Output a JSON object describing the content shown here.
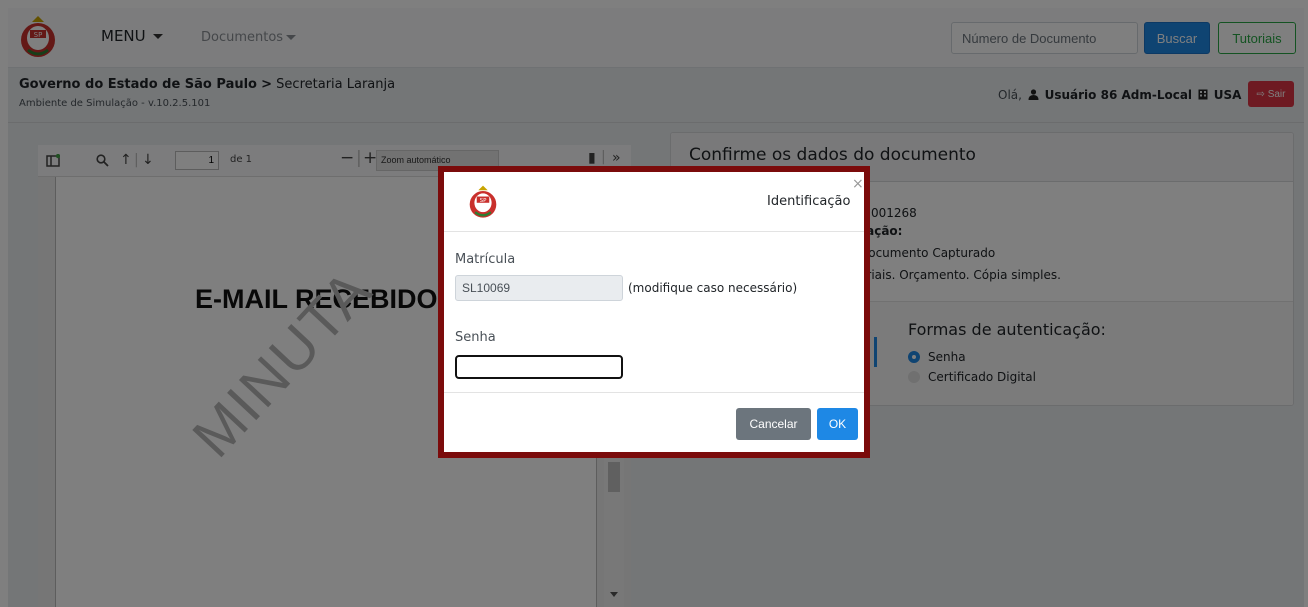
{
  "navbar": {
    "menu_label": "MENU",
    "documents_label": "Documentos",
    "search_placeholder": "Número de Documento",
    "search_button": "Buscar",
    "tutorials_button": "Tutoriais"
  },
  "subheader": {
    "breadcrumb_root": "Governo do Estado de São Paulo",
    "breadcrumb_separator": ">",
    "breadcrumb_current": "Secretaria Laranja",
    "environment": "Ambiente de Simulação - v.10.2.5.101",
    "greeting": "Olá,",
    "user_name": "Usuário 86 Adm-Local",
    "unit": "USA",
    "logout_button": "Sair"
  },
  "viewer": {
    "page_number": "1",
    "page_total": "de 1",
    "zoom": "Zoom automático",
    "document_title": "E-MAIL RECEBIDO",
    "watermark": "MINUTA"
  },
  "card": {
    "title": "Confirme os dados do documento",
    "doc_number_fragment": "-1001268",
    "classification_fragment": "cação:",
    "type_fragment": "Documento Capturado",
    "description_fragment": "eriais. Orçamento. Cópia simples.",
    "auth_title": "Formas de autenticação:",
    "auth_options": [
      {
        "label": "Senha",
        "selected": true
      },
      {
        "label": "Certificado Digital",
        "selected": false
      }
    ]
  },
  "modal": {
    "title": "Identificação",
    "close": "×",
    "matricula_label": "Matrícula",
    "matricula_value": "SL10069",
    "matricula_hint": "(modifique caso necessário)",
    "senha_label": "Senha",
    "cancel_button": "Cancelar",
    "ok_button": "OK"
  },
  "colors": {
    "primary": "#1e88e5",
    "success": "#28a745",
    "danger": "#dc3545",
    "modal_border": "#7b0b0b"
  }
}
